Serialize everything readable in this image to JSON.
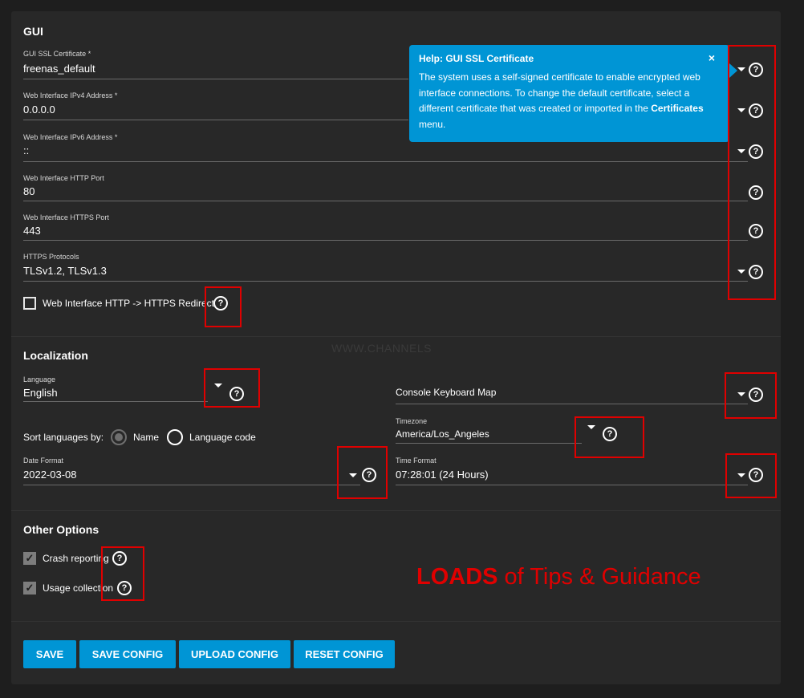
{
  "gui": {
    "title": "GUI",
    "ssl_cert": {
      "label": "GUI SSL Certificate *",
      "value": "freenas_default"
    },
    "ipv4": {
      "label": "Web Interface IPv4 Address *",
      "value": "0.0.0.0"
    },
    "ipv6": {
      "label": "Web Interface IPv6 Address *",
      "value": "::"
    },
    "http_port": {
      "label": "Web Interface HTTP Port",
      "value": "80"
    },
    "https_port": {
      "label": "Web Interface HTTPS Port",
      "value": "443"
    },
    "https_protocols": {
      "label": "HTTPS Protocols",
      "value": "TLSv1.2, TLSv1.3"
    },
    "redirect": {
      "label": "Web Interface HTTP -> HTTPS Redirect",
      "checked": false
    }
  },
  "tooltip": {
    "title": "Help: GUI SSL Certificate",
    "close": "×",
    "body_prefix": "The system uses a self-signed certificate to enable encrypted web interface connections. To change the default certificate, select a different certificate that was created or imported in the ",
    "body_bold": "Certificates",
    "body_suffix": " menu."
  },
  "localization": {
    "title": "Localization",
    "language": {
      "label": "Language",
      "value": "English"
    },
    "console_keyboard_map": {
      "label": "Console Keyboard Map",
      "value": ""
    },
    "sort_by": {
      "label": "Sort languages by:",
      "options": [
        "Name",
        "Language code"
      ],
      "selected": "Name"
    },
    "timezone": {
      "label": "Timezone",
      "value": "America/Los_Angeles"
    },
    "date_format": {
      "label": "Date Format",
      "value": "2022-03-08"
    },
    "time_format": {
      "label": "Time Format",
      "value": "07:28:01 (24 Hours)"
    }
  },
  "other": {
    "title": "Other Options",
    "crash_reporting": {
      "label": "Crash reporting",
      "checked": true
    },
    "usage_collection": {
      "label": "Usage collection",
      "checked": true
    }
  },
  "buttons": {
    "save": "SAVE",
    "save_config": "SAVE CONFIG",
    "upload_config": "UPLOAD CONFIG",
    "reset_config": "RESET CONFIG"
  },
  "help_glyph": "?",
  "check_glyph": "✓",
  "annotation": {
    "bold": "LOADS",
    "rest": " of Tips & Guidance"
  },
  "watermark": "WWW.CHANNELS",
  "colors": {
    "accent": "#0095d5",
    "annotation_red": "#e00000",
    "background": "#1e1e1e",
    "card": "#282828"
  }
}
